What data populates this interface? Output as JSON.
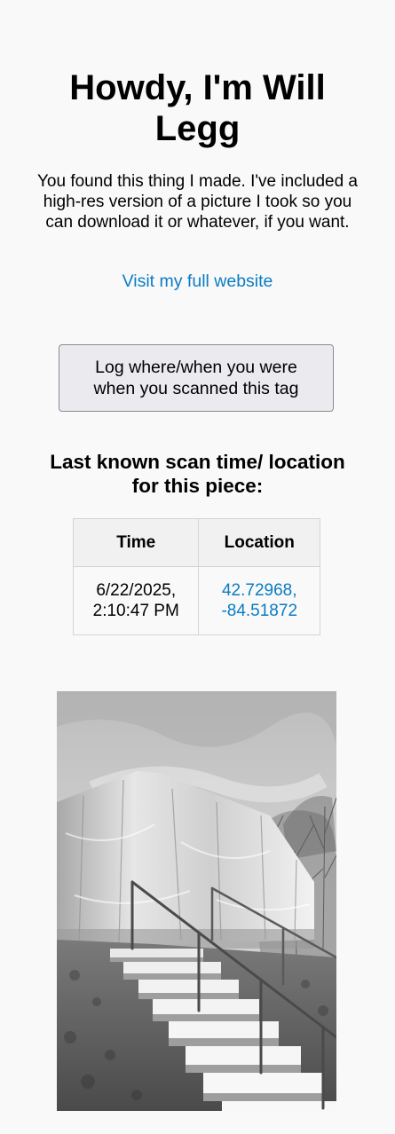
{
  "header": {
    "title": "Howdy, I'm Will Legg"
  },
  "intro": {
    "text": "You found this thing I made. I've included a high-res version of a picture I took so you can download it or whatever, if you want."
  },
  "links": {
    "website_label": "Visit my full website"
  },
  "log_button": {
    "label": "Log where/when you were when you scanned this tag"
  },
  "scan_section": {
    "heading": "Last known scan time/ location for this piece:",
    "columns": [
      "Time",
      "Location"
    ],
    "rows": [
      {
        "time": "6/22/2025, 2:10:47 PM",
        "location": "42.72968, -84.51872"
      }
    ]
  },
  "photo": {
    "subject": "black-and-white photo of concrete outdoor stairs with metal handrails leading up a grassy hill to a structure wrapped in translucent plastic sheeting, trees and cloudy sky behind"
  }
}
